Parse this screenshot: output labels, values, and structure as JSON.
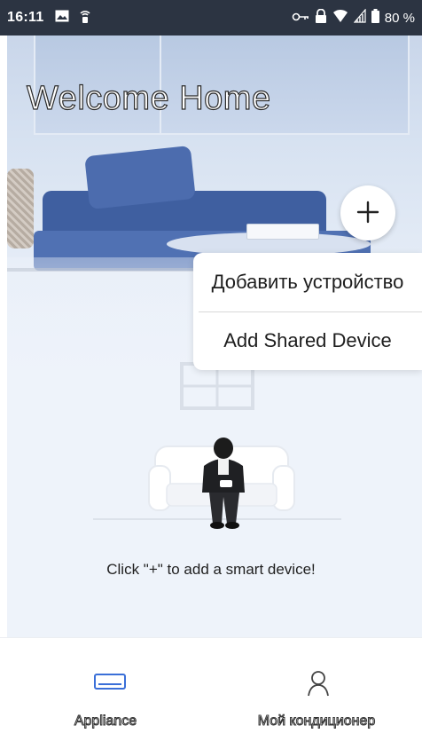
{
  "status_bar": {
    "time": "16:11",
    "battery": "80 %",
    "icons": [
      "image-icon",
      "cast-icon",
      "key-icon",
      "lock-icon",
      "wifi-icon",
      "signal-icon",
      "battery-icon"
    ]
  },
  "hero": {
    "title": "Welcome Home"
  },
  "add_menu": {
    "add_button_icon": "plus-icon",
    "items": [
      {
        "label": "Добавить устройство"
      },
      {
        "label": "Add Shared Device"
      }
    ]
  },
  "empty_state": {
    "hint": "Click \"+\" to add a smart device!"
  },
  "bottom_nav": {
    "items": [
      {
        "label": "Appliance",
        "icon": "appliance-icon",
        "active": true
      },
      {
        "label": "Мой кондиционер",
        "icon": "user-icon",
        "active": false
      }
    ]
  },
  "colors": {
    "status_bar": "#2c3442",
    "accent": "#3a6fd8",
    "sofa": "#3f5fa0"
  }
}
